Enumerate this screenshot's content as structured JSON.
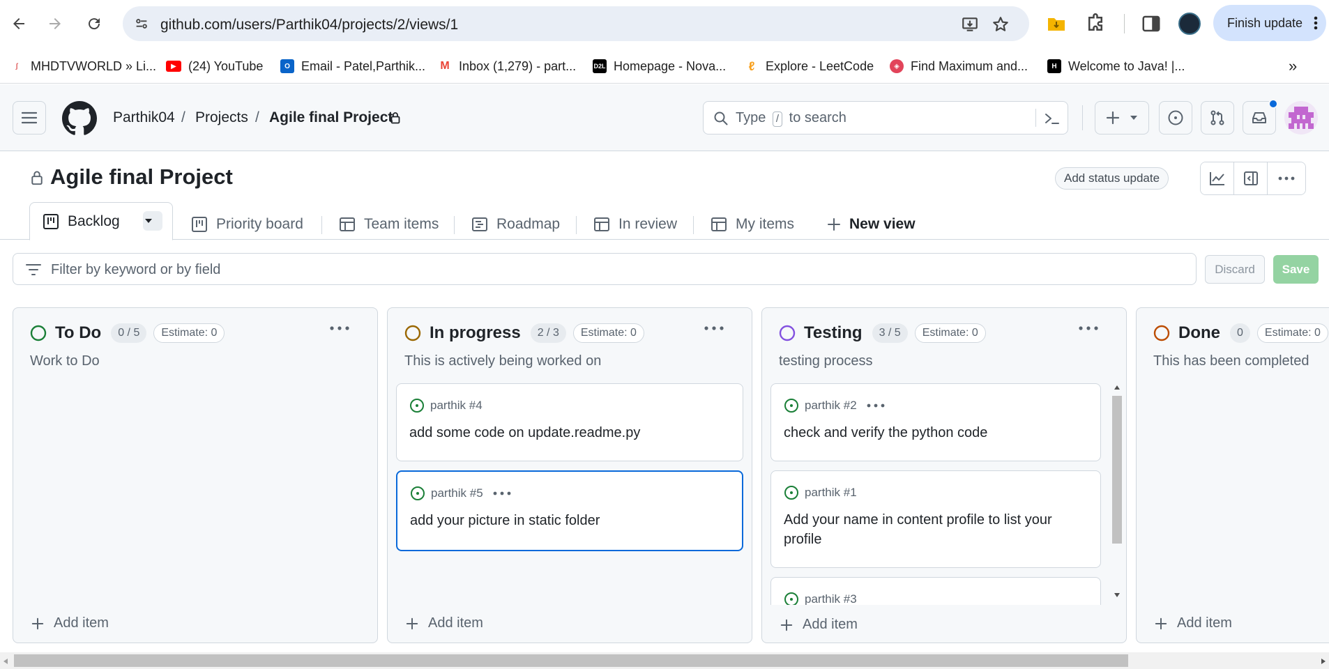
{
  "browser": {
    "url": "github.com/users/Parthik04/projects/2/views/1",
    "finish_update": "Finish update",
    "bookmarks": [
      {
        "label": "MHDTVWORLD » Li...",
        "icon": "mhdtv-icon"
      },
      {
        "label": "(24) YouTube",
        "icon": "youtube-icon"
      },
      {
        "label": "Email - Patel,Parthik...",
        "icon": "outlook-icon"
      },
      {
        "label": "Inbox (1,279) - part...",
        "icon": "gmail-icon"
      },
      {
        "label": "Homepage - Nova...",
        "icon": "d2l-icon"
      },
      {
        "label": "Explore - LeetCode",
        "icon": "leetcode-icon"
      },
      {
        "label": "Find Maximum and...",
        "icon": "tool-icon"
      },
      {
        "label": "Welcome to Java! |...",
        "icon": "hackerrank-icon"
      }
    ]
  },
  "header": {
    "owner": "Parthik04",
    "projects": "Projects",
    "project": "Agile final Project",
    "search_prefix": "Type",
    "search_key": "/",
    "search_suffix": "to search"
  },
  "project": {
    "title": "Agile final Project",
    "status_update": "Add status update"
  },
  "tabs": [
    "Backlog",
    "Priority board",
    "Team items",
    "Roadmap",
    "In review",
    "My items",
    "New view"
  ],
  "filter": {
    "placeholder": "Filter by keyword or by field",
    "discard": "Discard",
    "save": "Save"
  },
  "columns": [
    {
      "name": "To Do",
      "count": "0 / 5",
      "estimate": "Estimate: 0",
      "description": "Work to Do",
      "color": "#1a7f37",
      "add": "Add item",
      "cards": []
    },
    {
      "name": "In progress",
      "count": "2 / 3",
      "estimate": "Estimate: 0",
      "description": "This is actively being worked on",
      "color": "#9a6700",
      "add": "Add item",
      "cards": [
        {
          "meta": "parthik #4",
          "title": "add some code on update.readme.py"
        },
        {
          "meta": "parthik #5",
          "title": "add your picture in static folder"
        }
      ]
    },
    {
      "name": "Testing",
      "count": "3 / 5",
      "estimate": "Estimate: 0",
      "description": "testing process",
      "color": "#8250df",
      "add": "Add item",
      "cards": [
        {
          "meta": "parthik #2",
          "title": "check and verify the python code"
        },
        {
          "meta": "parthik #1",
          "title": "Add your name in content profile to list your profile"
        },
        {
          "meta": "parthik #3",
          "title": ""
        }
      ]
    },
    {
      "name": "Done",
      "count": "0",
      "estimate": "Estimate: 0",
      "description": "This has been completed",
      "color": "#bc4c00",
      "add": "Add item",
      "cards": []
    }
  ]
}
